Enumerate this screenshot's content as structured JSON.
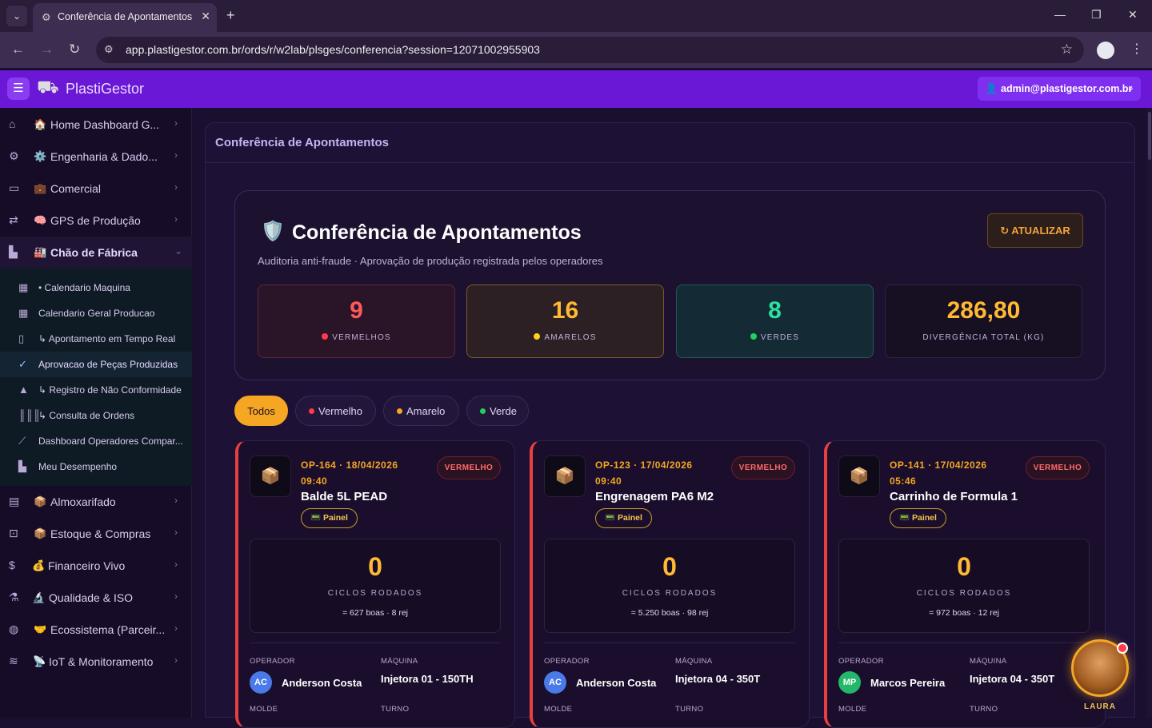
{
  "browser": {
    "tab_title": "Conferência de Apontamentos",
    "url": "app.plastigestor.com.br/ords/r/w2lab/plsges/conferencia?session=12071002955903"
  },
  "app": {
    "brand": "PlastiGestor",
    "user": "admin@plastigestor.com.br"
  },
  "sidebar": {
    "items": [
      {
        "label": "Home Dashboard G...",
        "emoji": "🏠",
        "icon": "home-icon"
      },
      {
        "label": "Engenharia & Dado...",
        "emoji": "⚙️",
        "icon": "gear-icon"
      },
      {
        "label": "Comercial",
        "emoji": "💼",
        "icon": "briefcase-icon"
      },
      {
        "label": "GPS de Produção",
        "emoji": "🧠",
        "icon": "route-icon"
      },
      {
        "label": "Chão de Fábrica",
        "emoji": "🏭",
        "icon": "factory-icon"
      },
      {
        "label": "Almoxarifado",
        "emoji": "📦",
        "icon": "archive-icon"
      },
      {
        "label": "Estoque & Compras",
        "emoji": "📦",
        "icon": "cart-icon"
      },
      {
        "label": "Financeiro Vivo",
        "emoji": "💰",
        "icon": "dollar-icon"
      },
      {
        "label": "Qualidade & ISO",
        "emoji": "🔬",
        "icon": "microscope-icon"
      },
      {
        "label": "Ecossistema (Parceir...",
        "emoji": "🤝",
        "icon": "globe-icon"
      },
      {
        "label": "IoT & Monitoramento",
        "emoji": "📡",
        "icon": "wifi-icon"
      }
    ],
    "sub_items": [
      {
        "label": "• Calendario Maquina"
      },
      {
        "label": "Calendario Geral Producao"
      },
      {
        "label": "↳ Apontamento em Tempo Real"
      },
      {
        "label": "Aprovacao de Peças Produzidas"
      },
      {
        "label": "↳ Registro de Não Conformidade"
      },
      {
        "label": "↳ Consulta de Ordens"
      },
      {
        "label": "Dashboard Operadores Compar..."
      },
      {
        "label": "Meu Desempenho"
      }
    ]
  },
  "page": {
    "region_title": "Conferência de Apontamentos",
    "hero_title": "Conferência de Apontamentos",
    "hero_subtitle": "Auditoria anti-fraude · Aprovação de produção registrada pelos operadores",
    "refresh_label": "↻ ATUALIZAR"
  },
  "kpis": {
    "red": {
      "value": "9",
      "label": "VERMELHOS",
      "color": "#ff3a4a"
    },
    "yellow": {
      "value": "16",
      "label": "AMARELOS",
      "color": "#ffd21a"
    },
    "green": {
      "value": "8",
      "label": "VERDES",
      "color": "#22d05a"
    },
    "divergence": {
      "value": "286,80",
      "label": "DIVERGÊNCIA TOTAL (KG)"
    }
  },
  "filters": {
    "all": "Todos",
    "red": "Vermelho",
    "yellow": "Amarelo",
    "green": "Verde"
  },
  "card_labels": {
    "cycles": "CICLOS RODADOS",
    "operator": "OPERADOR",
    "machine": "MÁQUINA",
    "mold": "MOLDE",
    "shift": "TURNO",
    "tag": "📟 Painel"
  },
  "cards": [
    {
      "op": "OP-164 · 18/04/2026 09:40",
      "status": "VERMELHO",
      "product": "Balde 5L PEAD",
      "cycles": "0",
      "detail": "= 627 boas · 8 rej",
      "operator": "Anderson Costa",
      "initials": "AC",
      "avatar_color": "#4a7ae8",
      "machine": "Injetora 01 - 150TH"
    },
    {
      "op": "OP-123 · 17/04/2026 09:40",
      "status": "VERMELHO",
      "product": "Engrenagem PA6 M2",
      "cycles": "0",
      "detail": "= 5.250 boas · 98 rej",
      "operator": "Anderson Costa",
      "initials": "AC",
      "avatar_color": "#4a7ae8",
      "machine": "Injetora 04 - 350T"
    },
    {
      "op": "OP-141 · 17/04/2026 05:46",
      "status": "VERMELHO",
      "product": "Carrinho de Formula 1",
      "cycles": "0",
      "detail": "= 972 boas · 12 rej",
      "operator": "Marcos Pereira",
      "initials": "MP",
      "avatar_color": "#22b86a",
      "machine": "Injetora 04 - 350T"
    }
  ],
  "assistant": {
    "name": "LAURA"
  }
}
